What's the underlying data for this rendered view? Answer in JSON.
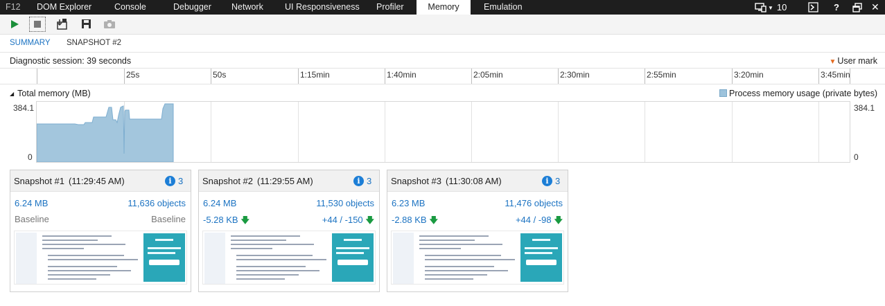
{
  "top_tabs": [
    {
      "label": "F12"
    },
    {
      "label": "DOM Explorer"
    },
    {
      "label": "Console"
    },
    {
      "label": "Debugger"
    },
    {
      "label": "Network"
    },
    {
      "label": "UI Responsiveness"
    },
    {
      "label": "Profiler"
    },
    {
      "label": "Memory"
    },
    {
      "label": "Emulation"
    }
  ],
  "active_tab": "Memory",
  "top_right": {
    "target_count": "10",
    "icons": [
      "device-target-icon",
      "console-icon",
      "help-icon",
      "undock-icon",
      "close-icon"
    ]
  },
  "toolbar": {
    "icons": [
      "play-icon",
      "stop-icon",
      "import-icon",
      "save-icon",
      "camera-icon"
    ]
  },
  "subtabs": [
    {
      "label": "SUMMARY"
    },
    {
      "label": "SNAPSHOT #2"
    }
  ],
  "session": {
    "label": "Diagnostic session: 39 seconds",
    "user_mark": "User mark"
  },
  "ruler": {
    "ticks": [
      "25s",
      "50s",
      "1:15min",
      "1:40min",
      "2:05min",
      "2:30min",
      "2:55min",
      "3:20min",
      "3:45min"
    ]
  },
  "memory": {
    "title": "Total memory (MB)",
    "legend": "Process memory usage (private bytes)",
    "y_max_label": "384.1",
    "y_min_label": "0",
    "colors": {
      "fill": "#9dc3dc",
      "stroke": "#7aa9c8"
    }
  },
  "snapshots": [
    {
      "title": "Snapshot #1",
      "time": "(11:29:45 AM)",
      "info_count": "3",
      "size": "6.24 MB",
      "objects": "11,636 objects",
      "size_delta": "Baseline",
      "objects_delta": "Baseline",
      "is_baseline": true
    },
    {
      "title": "Snapshot #2",
      "time": "(11:29:55 AM)",
      "info_count": "3",
      "size": "6.24 MB",
      "objects": "11,530 objects",
      "size_delta": "-5.28 KB",
      "objects_delta": "+44 / -150",
      "is_baseline": false
    },
    {
      "title": "Snapshot #3",
      "time": "(11:30:08 AM)",
      "info_count": "3",
      "size": "6.23 MB",
      "objects": "11,476 objects",
      "size_delta": "-2.88 KB",
      "objects_delta": "+44 / -98",
      "is_baseline": false
    }
  ]
}
